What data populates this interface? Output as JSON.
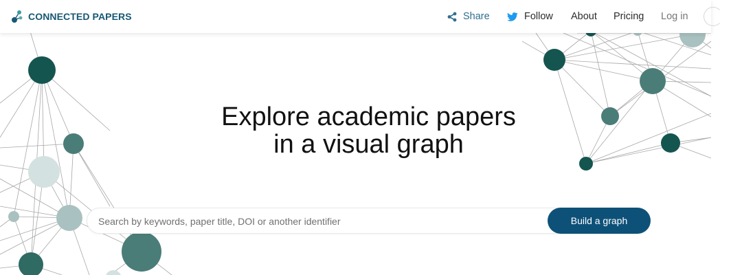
{
  "header": {
    "brand": "CONNECTED PAPERS",
    "nav": {
      "share": "Share",
      "follow": "Follow",
      "about": "About",
      "pricing": "Pricing",
      "login": "Log in"
    },
    "icons": {
      "logo": "connected-papers-logo-icon",
      "share": "share-icon",
      "follow": "twitter-bird-icon"
    }
  },
  "hero": {
    "headline_line1": "Explore academic papers",
    "headline_line2": "in a visual graph"
  },
  "search": {
    "placeholder": "Search by keywords, paper title, DOI or another identifier",
    "value": "",
    "button_label": "Build a graph"
  },
  "colors": {
    "brand": "#175873",
    "button": "#0e5178",
    "share": "#2f6f8f",
    "twitter": "#1d9bf0",
    "node_dark": "#155550",
    "node_mid": "#4b7d78",
    "node_light": "#a9c1c0",
    "node_pale": "#d3e1e0"
  }
}
